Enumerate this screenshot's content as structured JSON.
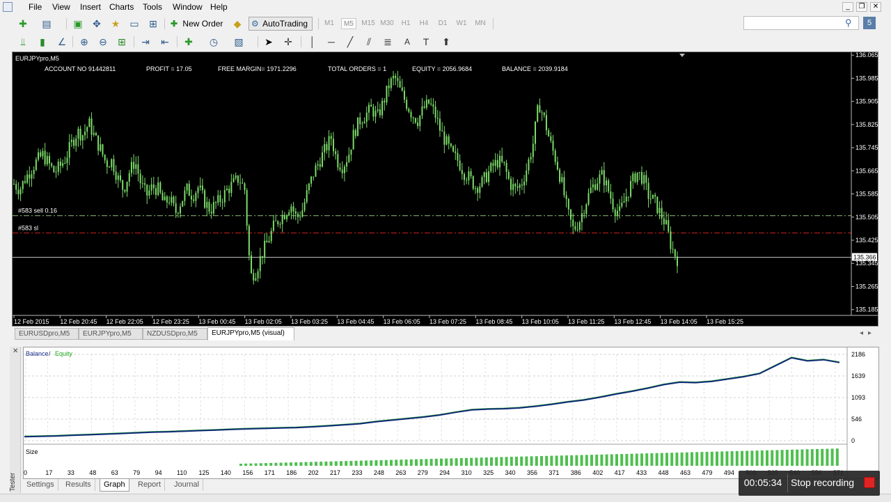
{
  "menu": {
    "items": [
      "File",
      "View",
      "Insert",
      "Charts",
      "Tools",
      "Window",
      "Help"
    ]
  },
  "window_controls": {
    "minimize": "_",
    "restore": "❐",
    "close": "✕"
  },
  "toolbar": {
    "new_order": "New Order",
    "autotrading": "AutoTrading",
    "timeframes": [
      "M1",
      "M5",
      "M15",
      "M30",
      "H1",
      "H4",
      "D1",
      "W1",
      "MN"
    ],
    "selected_timeframe": "M5"
  },
  "chart": {
    "symbol": "EURJPYpro,M5",
    "info": {
      "account": "ACCOUNT NO  91442811",
      "profit": "PROFIT = 17.05",
      "free_margin": "FREE MARGIN=  1971.2296",
      "total_orders": "TOTAL ORDERS =  1",
      "equity": "EQUITY =  2056.9684",
      "balance": "BALANCE =  2039.9184"
    },
    "sell_line_label": "#583 sell 0.16",
    "sl_line_label": "#583 sl",
    "current_price": "135.366",
    "colors": {
      "bg": "#000000",
      "bull": "#7ddc6a",
      "sell_line": "#8fbf7a",
      "sl_line": "#d22020"
    }
  },
  "chart_data": {
    "type": "bar",
    "y_ticks": [
      "136.065",
      "135.985",
      "135.905",
      "135.825",
      "135.745",
      "135.665",
      "135.585",
      "135.505",
      "135.425",
      "135.345",
      "135.265",
      "135.185"
    ],
    "ylim": [
      135.165,
      136.075
    ],
    "x_ticks": [
      "12 Feb 2015",
      "12 Feb 20:45",
      "12 Feb 22:05",
      "12 Feb 23:25",
      "13 Feb 00:45",
      "13 Feb 02:05",
      "13 Feb 03:25",
      "13 Feb 04:45",
      "13 Feb 06:05",
      "13 Feb 07:25",
      "13 Feb 08:45",
      "13 Feb 10:05",
      "13 Feb 11:25",
      "13 Feb 12:45",
      "13 Feb 14:05",
      "13 Feb 15:25"
    ],
    "close_path": [
      135.62,
      135.6,
      135.64,
      135.67,
      135.7,
      135.72,
      135.69,
      135.66,
      135.68,
      135.71,
      135.76,
      135.8,
      135.79,
      135.83,
      135.78,
      135.74,
      135.69,
      135.7,
      135.64,
      135.6,
      135.66,
      135.7,
      135.62,
      135.58,
      135.61,
      135.6,
      135.55,
      135.57,
      135.52,
      135.56,
      135.6,
      135.58,
      135.61,
      135.56,
      135.53,
      135.55,
      135.57,
      135.6,
      135.62,
      135.64,
      135.6,
      135.3,
      135.32,
      135.38,
      135.42,
      135.47,
      135.5,
      135.52,
      135.55,
      135.5,
      135.53,
      135.6,
      135.66,
      135.7,
      135.74,
      135.78,
      135.7,
      135.68,
      135.72,
      135.8,
      135.84,
      135.86,
      135.88,
      135.85,
      135.9,
      135.96,
      135.99,
      135.94,
      135.9,
      135.86,
      135.84,
      135.88,
      135.9,
      135.86,
      135.8,
      135.76,
      135.72,
      135.7,
      135.66,
      135.64,
      135.61,
      135.62,
      135.65,
      135.68,
      135.7,
      135.68,
      135.62,
      135.6,
      135.62,
      135.68,
      135.76,
      135.9,
      135.84,
      135.76,
      135.7,
      135.62,
      135.52,
      135.46,
      135.49,
      135.55,
      135.6,
      135.63,
      135.65,
      135.6,
      135.54,
      135.52,
      135.57,
      135.62,
      135.66,
      135.64,
      135.58,
      135.56,
      135.52,
      135.48,
      135.4,
      135.36
    ],
    "sell_price": 135.51,
    "sl_price": 135.45,
    "current_price": 135.366
  },
  "chart_tabs": [
    "EURUSDpro,M5",
    "EURJPYpro,M5",
    "NZDUSDpro,M5",
    "EURJPYpro,M5 (visual)"
  ],
  "tester": {
    "legend_balance": "Balance",
    "legend_sep": " / ",
    "legend_equity": "Equity",
    "size_label": "Size",
    "y_ticks": [
      "2186",
      "1639",
      "1093",
      "546",
      "0"
    ],
    "x_ticks": [
      "0",
      "17",
      "33",
      "48",
      "63",
      "79",
      "94",
      "110",
      "125",
      "140",
      "156",
      "171",
      "186",
      "202",
      "217",
      "233",
      "248",
      "263",
      "279",
      "294",
      "310",
      "325",
      "340",
      "356",
      "371",
      "386",
      "402",
      "417",
      "433",
      "448",
      "463",
      "479",
      "494",
      "509",
      "525",
      "540",
      "556",
      "571"
    ],
    "balance_curve": [
      100,
      110,
      120,
      135,
      150,
      165,
      180,
      200,
      215,
      225,
      240,
      255,
      270,
      285,
      300,
      310,
      320,
      330,
      350,
      375,
      400,
      430,
      480,
      520,
      560,
      600,
      650,
      720,
      780,
      800,
      810,
      830,
      870,
      920,
      980,
      1030,
      1100,
      1180,
      1250,
      1330,
      1420,
      1480,
      1470,
      1500,
      1560,
      1620,
      1700,
      1900,
      2100,
      2020,
      2050,
      1980
    ],
    "tabs": [
      "Settings",
      "Results",
      "Graph",
      "Report",
      "Journal"
    ],
    "active_tab": "Graph",
    "side_label": "Tester"
  },
  "recording": {
    "time": "00:05:34",
    "stop_label": "Stop recording"
  }
}
